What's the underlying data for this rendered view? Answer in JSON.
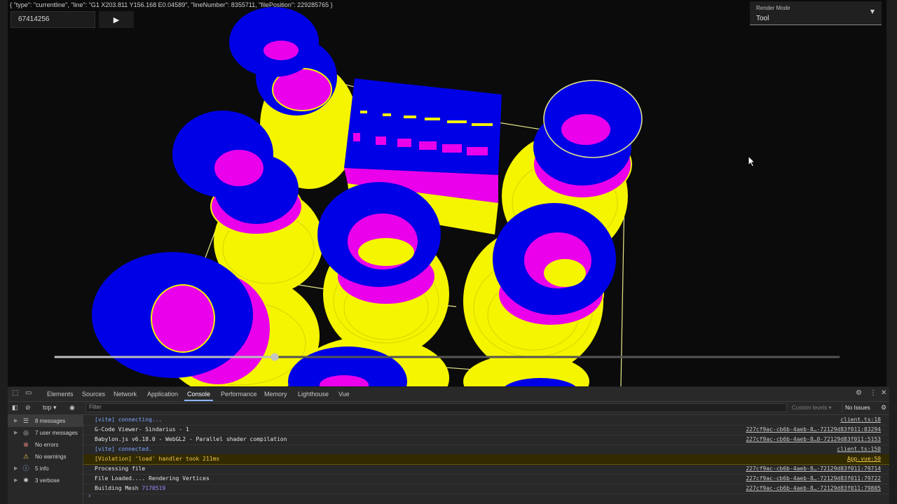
{
  "viewer": {
    "status_line": "{ \"type\": \"currentline\", \"line\": \"G1 X203.811 Y156.168 E0.04589\", \"lineNumber\": 8355711, \"filePosition\": 229285765 }",
    "position_value": "67414256",
    "play_icon": "play-icon",
    "render_mode": {
      "label": "Render Mode",
      "value": "Tool"
    },
    "scrubber_progress": 0.28,
    "colors": {
      "background": "#0b0b0b",
      "extrusion_blue": "#0000e6",
      "extrusion_yellow": "#f5f500",
      "extrusion_magenta": "#ea00ea",
      "travel_line": "#e8e88a"
    }
  },
  "devtools": {
    "tabs": [
      "Elements",
      "Sources",
      "Network",
      "Application",
      "Console",
      "Performance",
      "Memory",
      "Lighthouse",
      "Vue"
    ],
    "active_tab": "Console",
    "context": "top",
    "filter_placeholder": "Filter",
    "custom_levels": "Custom levels ▾",
    "issues": "No Issues",
    "sidebar": [
      {
        "label": "8 messages",
        "icon": "list-icon"
      },
      {
        "label": "7 user messages",
        "icon": "user-icon"
      },
      {
        "label": "No errors",
        "icon": "error-icon"
      },
      {
        "label": "No warnings",
        "icon": "warning-icon"
      },
      {
        "label": "5 info",
        "icon": "info-icon"
      },
      {
        "label": "3 verbose",
        "icon": "bug-icon"
      }
    ],
    "console": [
      {
        "msg": "[vite] connecting...",
        "src": "client.ts:18",
        "kind": "vite"
      },
      {
        "msg": "G-Code Viewer- Sindarius - 1",
        "src": "227cf9ac-cb6b-4aeb-8…-72129d83f011:83294",
        "kind": "log"
      },
      {
        "msg": "Babylon.js v6.18.0 - WebGL2 - Parallel shader compilation",
        "src": "227cf9ac-cb6b-4aeb-8…0-72129d83f011:5153",
        "kind": "log"
      },
      {
        "msg": "[vite] connected.",
        "src": "client.ts:150",
        "kind": "vite"
      },
      {
        "msg": "[Violation] 'load' handler took 211ms",
        "src": "App.vue:50",
        "kind": "warn"
      },
      {
        "msg": "Processing file",
        "src": "227cf9ac-cb6b-4aeb-8…-72129d83f011:79714",
        "kind": "log"
      },
      {
        "msg": "File Loaded.... Rendering Vertices",
        "src": "227cf9ac-cb6b-4aeb-8…-72129d83f011:79722",
        "kind": "log"
      },
      {
        "msg": "Building Mesh ",
        "num": "7170519",
        "src": "227cf9ac-cb6b-4aeb-8…-72129d83f011:79805",
        "kind": "log"
      }
    ]
  }
}
